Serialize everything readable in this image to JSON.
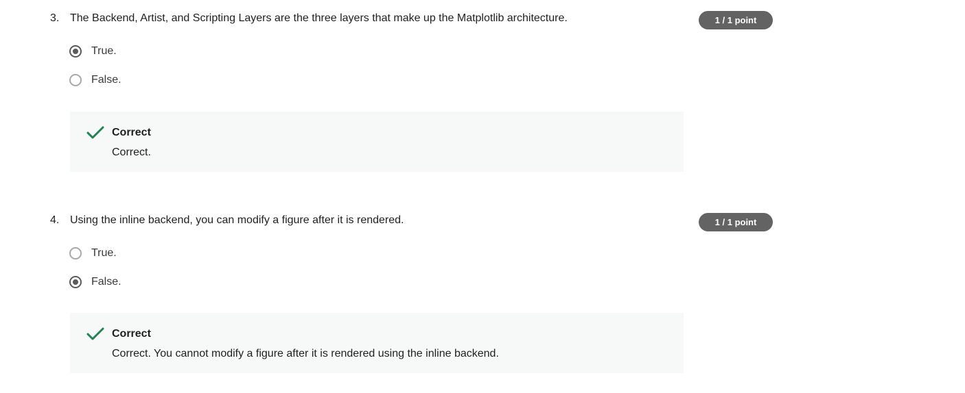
{
  "questions": [
    {
      "number": "3.",
      "text": "The Backend, Artist, and Scripting Layers are the three layers that make up the Matplotlib architecture.",
      "points": "1 / 1 point",
      "options": [
        {
          "label": "True.",
          "selected": true
        },
        {
          "label": "False.",
          "selected": false
        }
      ],
      "feedback": {
        "title": "Correct",
        "text": "Correct.",
        "icon": "checkmark-icon",
        "icon_color": "#1f8354"
      }
    },
    {
      "number": "4.",
      "text": "Using the inline backend, you can modify a figure after it is rendered.",
      "points": "1 / 1 point",
      "options": [
        {
          "label": "True.",
          "selected": false
        },
        {
          "label": "False.",
          "selected": true
        }
      ],
      "feedback": {
        "title": "Correct",
        "text": "Correct. You cannot modify a figure after it is rendered using the inline backend.",
        "icon": "checkmark-icon",
        "icon_color": "#1f8354"
      }
    }
  ],
  "colors": {
    "badge_bg": "#636363",
    "feedback_bg": "#f6f9f8",
    "correct_green": "#1f8354"
  }
}
